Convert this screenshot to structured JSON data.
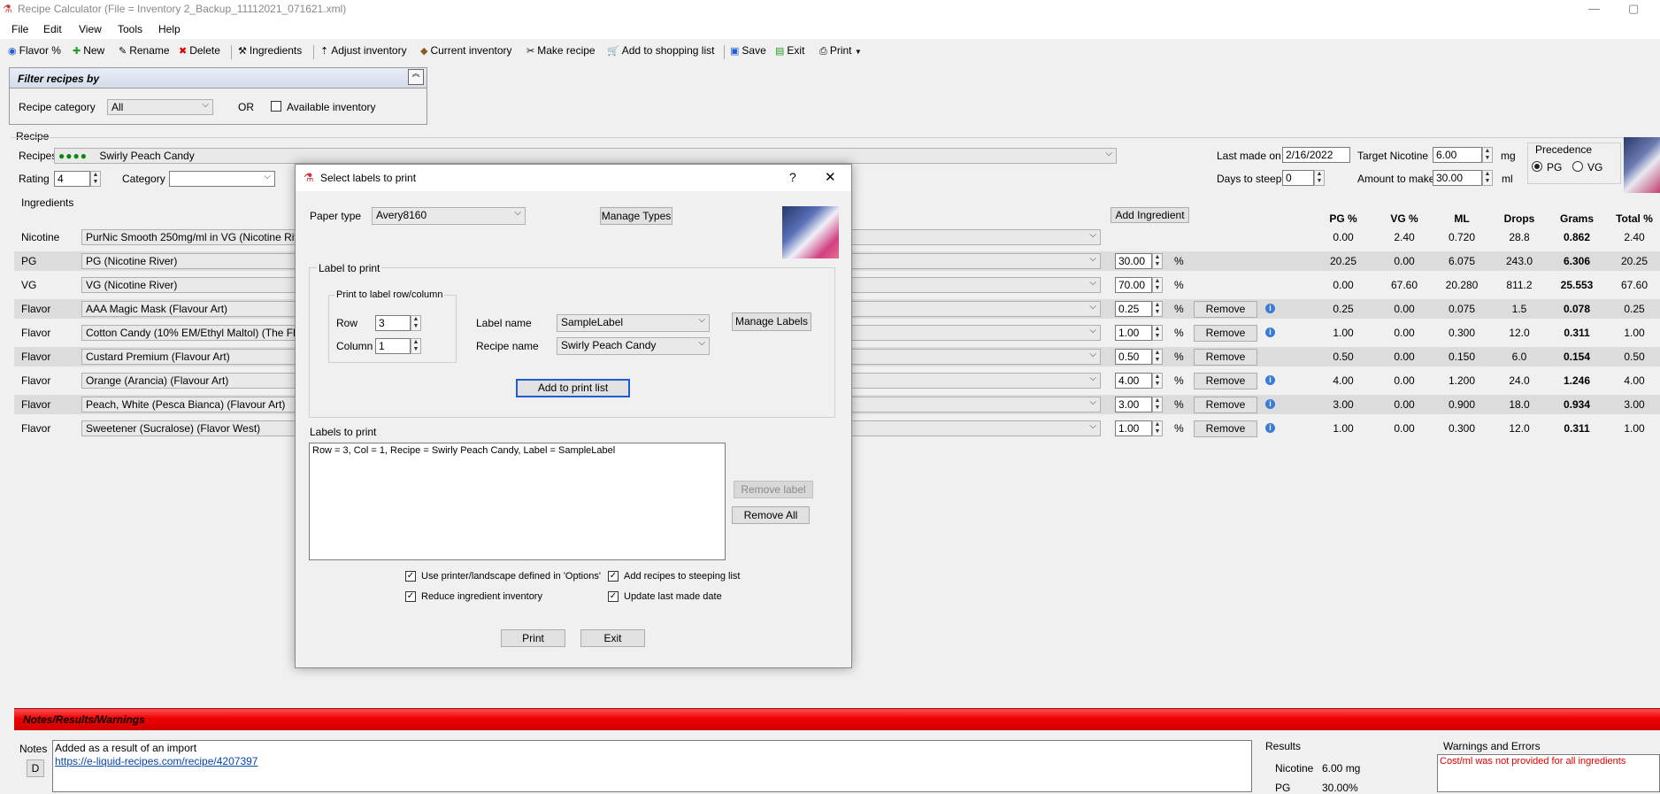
{
  "window": {
    "title": "Recipe Calculator (File = Inventory 2_Backup_11112021_071621.xml)",
    "min_icon": "—",
    "max_icon": "▢"
  },
  "menu": [
    "File",
    "Edit",
    "View",
    "Tools",
    "Help"
  ],
  "toolbar": {
    "flavor_pct": "Flavor %",
    "new": "New",
    "rename": "Rename",
    "delete": "Delete",
    "ingredients": "Ingredients",
    "adjust_inventory": "Adjust inventory",
    "current_inventory": "Current inventory",
    "make_recipe": "Make recipe",
    "add_to_shopping_list": "Add to shopping list",
    "save": "Save",
    "exit": "Exit",
    "print": "Print"
  },
  "filter": {
    "title": "Filter recipes by",
    "category_label": "Recipe category",
    "category_value": "All",
    "or_label": "OR",
    "available_label": "Available inventory"
  },
  "recipe": {
    "group_label": "Recipe",
    "recipes_label": "Recipes",
    "dots": "●●●●",
    "name": "Swirly Peach Candy",
    "rating_label": "Rating",
    "rating": "4",
    "category_label": "Category",
    "category_value": "",
    "last_made_label": "Last made on",
    "last_made": "2/16/2022",
    "target_nic_label": "Target Nicotine",
    "target_nic": "6.00",
    "target_unit": "mg",
    "days_label": "Days to steep",
    "days": "0",
    "amount_label": "Amount to make",
    "amount": "30.00",
    "amount_unit": "ml",
    "precedence_label": "Precedence",
    "pg": "PG",
    "vg": "VG"
  },
  "ingredients": {
    "group_label": "Ingredients",
    "add_button": "Add Ingredient",
    "remove_label": "Remove",
    "pct_sign": "%",
    "columns": [
      "PG %",
      "VG %",
      "ML",
      "Drops",
      "Grams",
      "Total %"
    ],
    "rows": [
      {
        "type": "Nicotine",
        "name": "PurNic Smooth 250mg/ml in VG (Nicotine River)",
        "pct": "",
        "remove": false,
        "info": false,
        "pg": "0.00",
        "vg": "2.40",
        "ml": "0.720",
        "drops": "28.8",
        "grams": "0.862",
        "total": "2.40"
      },
      {
        "type": "PG",
        "name": "PG (Nicotine River)",
        "pct": "30.00",
        "remove": false,
        "info": false,
        "pg": "20.25",
        "vg": "0.00",
        "ml": "6.075",
        "drops": "243.0",
        "grams": "6.306",
        "total": "20.25"
      },
      {
        "type": "VG",
        "name": "VG (Nicotine River)",
        "pct": "70.00",
        "remove": false,
        "info": false,
        "pg": "0.00",
        "vg": "67.60",
        "ml": "20.280",
        "drops": "811.2",
        "grams": "25.553",
        "total": "67.60"
      },
      {
        "type": "Flavor",
        "name": "AAA Magic Mask (Flavour Art)",
        "pct": "0.25",
        "remove": true,
        "info": true,
        "pg": "0.25",
        "vg": "0.00",
        "ml": "0.075",
        "drops": "1.5",
        "grams": "0.078",
        "total": "0.25"
      },
      {
        "type": "Flavor",
        "name": "Cotton Candy (10% EM/Ethyl Maltol) (The Flavor A",
        "pct": "1.00",
        "remove": true,
        "info": true,
        "pg": "1.00",
        "vg": "0.00",
        "ml": "0.300",
        "drops": "12.0",
        "grams": "0.311",
        "total": "1.00"
      },
      {
        "type": "Flavor",
        "name": "Custard Premium (Flavour Art)",
        "pct": "0.50",
        "remove": true,
        "info": false,
        "pg": "0.50",
        "vg": "0.00",
        "ml": "0.150",
        "drops": "6.0",
        "grams": "0.154",
        "total": "0.50"
      },
      {
        "type": "Flavor",
        "name": "Orange (Arancia) (Flavour Art)",
        "pct": "4.00",
        "remove": true,
        "info": true,
        "pg": "4.00",
        "vg": "0.00",
        "ml": "1.200",
        "drops": "24.0",
        "grams": "1.246",
        "total": "4.00"
      },
      {
        "type": "Flavor",
        "name": "Peach, White (Pesca Bianca) (Flavour Art)",
        "pct": "3.00",
        "remove": true,
        "info": true,
        "pg": "3.00",
        "vg": "0.00",
        "ml": "0.900",
        "drops": "18.0",
        "grams": "0.934",
        "total": "3.00"
      },
      {
        "type": "Flavor",
        "name": "Sweetener (Sucralose) (Flavor West)",
        "pct": "1.00",
        "remove": true,
        "info": true,
        "pg": "1.00",
        "vg": "0.00",
        "ml": "0.300",
        "drops": "12.0",
        "grams": "0.311",
        "total": "1.00"
      }
    ]
  },
  "notes": {
    "bar_title": "Notes/Results/Warnings",
    "notes_label": "Notes",
    "d_button": "D",
    "note_text": "Added as a result of an import",
    "note_link": "https://e-liquid-recipes.com/recipe/4207397",
    "results_label": "Results",
    "nicotine_label": "Nicotine",
    "nicotine_value": "6.00 mg",
    "pg_label": "PG",
    "pg_value": "30.00%",
    "warnings_label": "Warnings and Errors",
    "warning_text": "Cost/ml was not provided for all ingredients"
  },
  "dialog": {
    "title": "Select labels to print",
    "help": "?",
    "close": "✕",
    "paper_type_label": "Paper type",
    "paper_type": "Avery8160",
    "manage_types": "Manage Types",
    "label_to_print": "Label to print",
    "print_to_rowcol": "Print to label row/column",
    "row_label": "Row",
    "row": "3",
    "col_label": "Column",
    "col": "1",
    "label_name_label": "Label name",
    "label_name": "SampleLabel",
    "recipe_name_label": "Recipe name",
    "recipe_name": "Swirly Peach Candy",
    "manage_labels": "Manage Labels",
    "add_to_print_list": "Add to print list",
    "labels_to_print": "Labels to print",
    "list_items": [
      "Row = 3, Col = 1, Recipe = Swirly Peach Candy, Label = SampleLabel"
    ],
    "remove_label": "Remove label",
    "remove_all": "Remove All",
    "opt_printer": "Use printer/landscape defined in 'Options'",
    "opt_steeping": "Add recipes to steeping list",
    "opt_reduce": "Reduce ingredient inventory",
    "opt_update": "Update last made date",
    "print": "Print",
    "exit": "Exit"
  },
  "colors": {
    "accent_red": "#ee0000",
    "link_blue": "#0645ad",
    "focus_blue": "#1e5bd6"
  }
}
